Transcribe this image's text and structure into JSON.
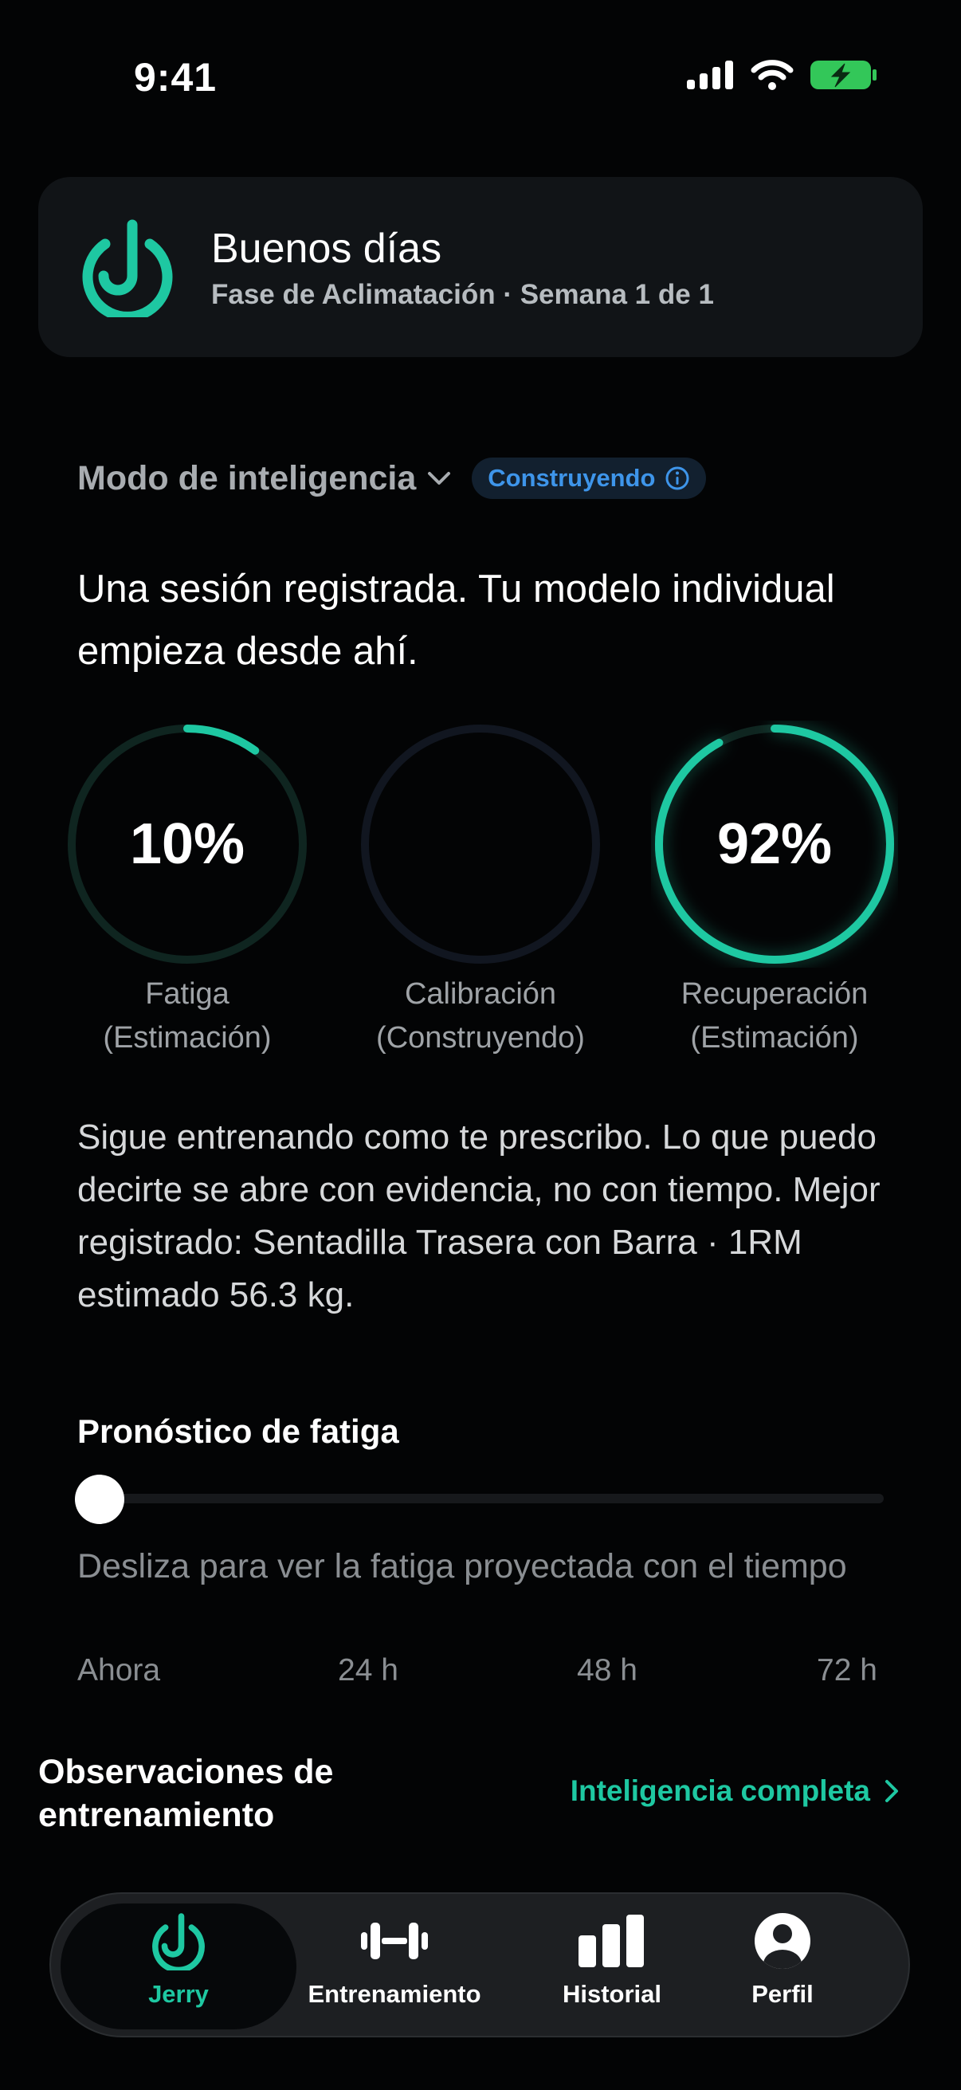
{
  "status_bar": {
    "time": "9:41"
  },
  "header": {
    "greeting": "Buenos días",
    "phase": "Fase de Aclimatación · Semana 1 de 1"
  },
  "intelligence": {
    "mode_label": "Modo de inteligencia",
    "badge": "Construyendo",
    "headline": "Una sesión registrada. Tu modelo individual empieza desde ahí."
  },
  "rings": [
    {
      "value": "10%",
      "label_line1": "Fatiga",
      "label_line2": "(Estimación)",
      "progress": 0.1
    },
    {
      "value": "",
      "label_line1": "Calibración",
      "label_line2": "(Construyendo)",
      "progress": 0
    },
    {
      "value": "92%",
      "label_line1": "Recuperación",
      "label_line2": "(Estimación)",
      "progress": 0.92
    }
  ],
  "summary": "Sigue entrenando como te prescribo. Lo que puedo decirte se abre con evidencia, no con tiempo. Mejor registrado: Sentadilla Trasera con Barra · 1RM estimado 56.3 kg.",
  "forecast": {
    "title": "Pronóstico de fatiga",
    "hint": "Desliza para ver la fatiga proyectada con el tiempo",
    "slider_value": 0,
    "ticks": [
      "Ahora",
      "24 h",
      "48 h",
      "72 h"
    ]
  },
  "observations": {
    "title": "Observaciones de entrenamiento",
    "link": "Inteligencia completa"
  },
  "tabs": [
    {
      "label": "Jerry",
      "icon": "jerry-logo-icon",
      "active": true
    },
    {
      "label": "Entrenamiento",
      "icon": "dumbbell-icon",
      "active": false
    },
    {
      "label": "Historial",
      "icon": "bar-chart-icon",
      "active": false
    },
    {
      "label": "Perfil",
      "icon": "person-icon",
      "active": false
    }
  ],
  "colors": {
    "accent": "#1ec8a2",
    "badge_blue": "#3e95ea",
    "background": "#030405"
  }
}
